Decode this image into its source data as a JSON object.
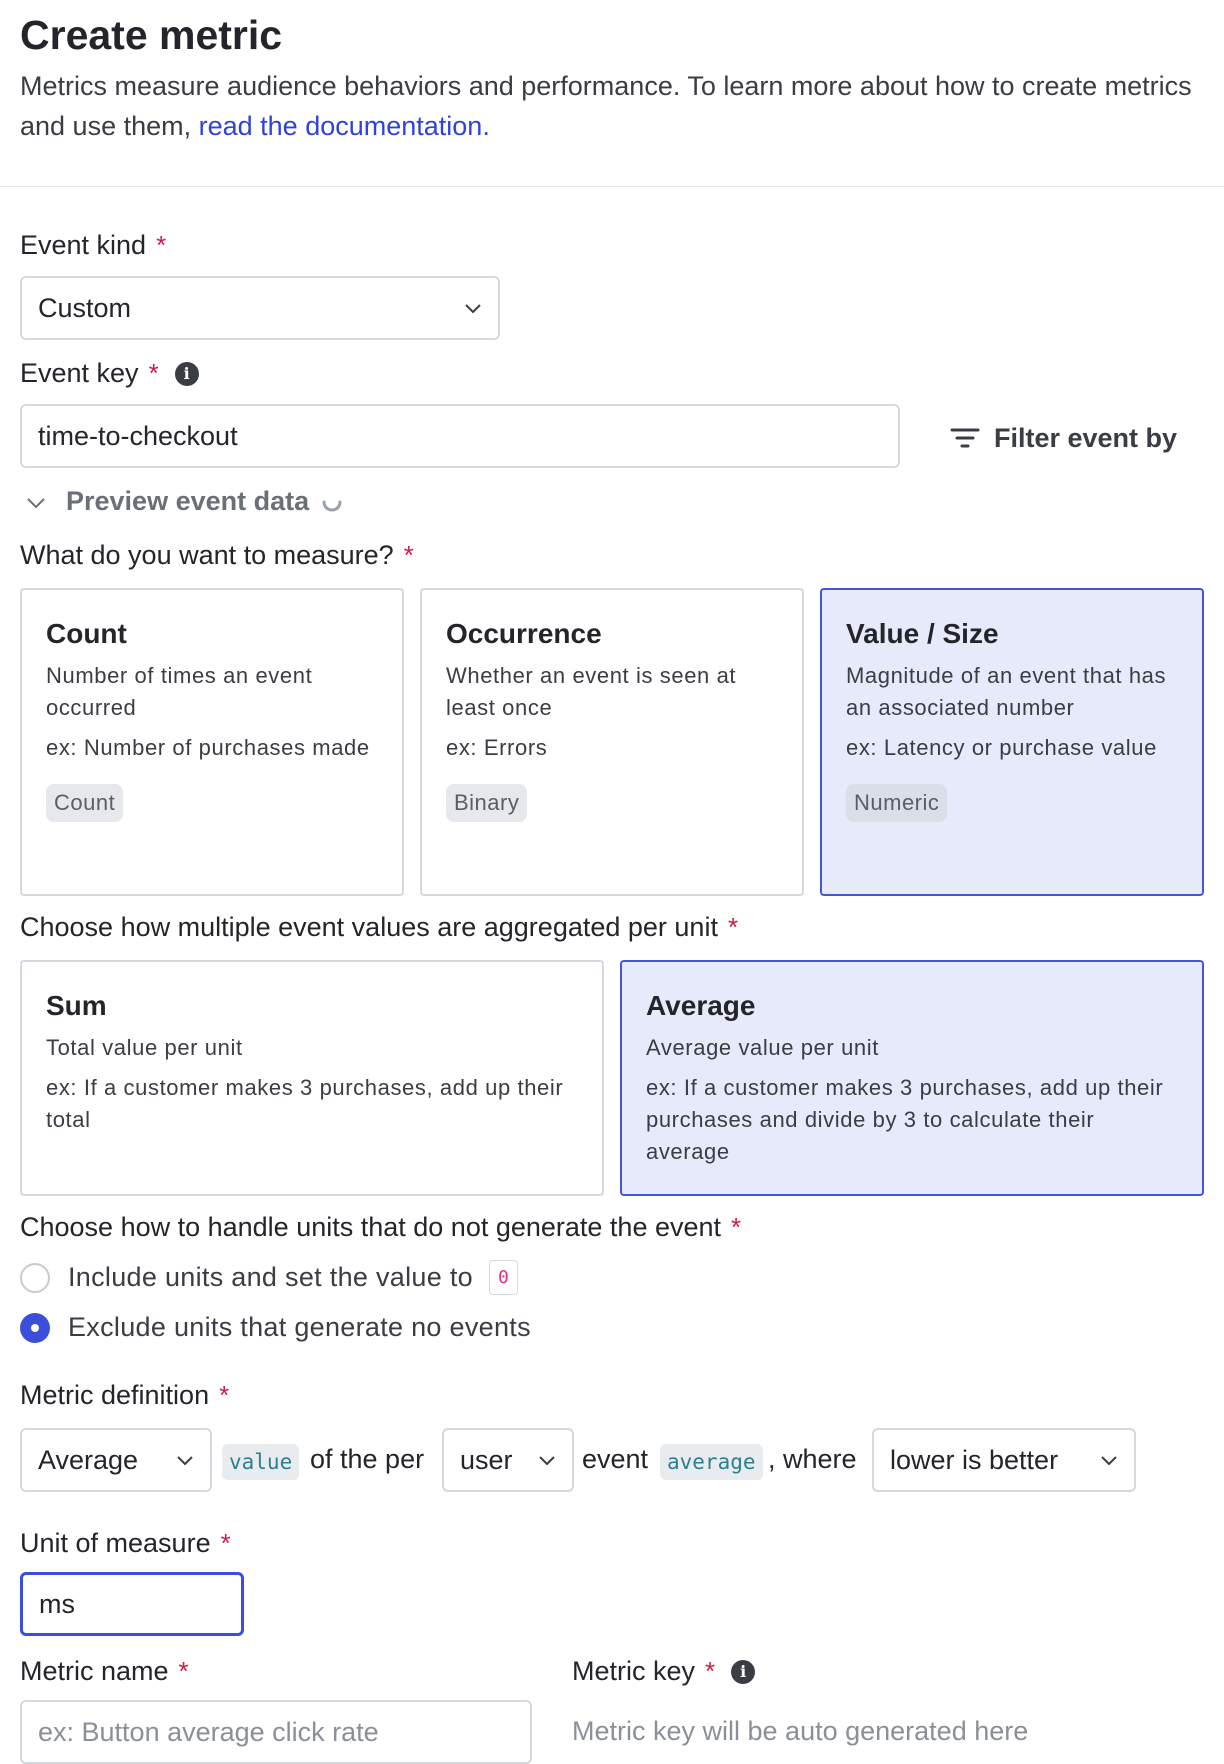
{
  "page": {
    "title": "Create metric",
    "description": "Metrics measure audience behaviors and performance. To learn more about how to create metrics and use them, ",
    "doc_link": "read the documentation."
  },
  "event_kind": {
    "label": "Event kind",
    "required": "*",
    "value": "Custom"
  },
  "event_key": {
    "label": "Event key",
    "required": "*",
    "value": "time-to-checkout",
    "info_icon": "info-icon"
  },
  "filter_button": {
    "label": "Filter event by",
    "icon": "filter-icon"
  },
  "preview": {
    "label": "Preview event data"
  },
  "measure": {
    "label": "What do you want to measure?",
    "required": "*",
    "options": [
      {
        "title": "Count",
        "desc": "Number of times an event occurred",
        "example": "ex: Number of purchases made",
        "tag": "Count",
        "selected": false
      },
      {
        "title": "Occurrence",
        "desc": "Whether an event is seen at least once",
        "example": "ex: Errors",
        "tag": "Binary",
        "selected": false
      },
      {
        "title": "Value / Size",
        "desc": "Magnitude of an event that has an associated number",
        "example": "ex: Latency or purchase value",
        "tag": "Numeric",
        "selected": true
      }
    ]
  },
  "aggregation": {
    "label": "Choose how multiple event values are aggregated per unit",
    "required": "*",
    "options": [
      {
        "title": "Sum",
        "desc": "Total value per unit",
        "example": "ex: If a customer makes 3 purchases, add up their total",
        "selected": false
      },
      {
        "title": "Average",
        "desc": "Average value per unit",
        "example": "ex: If a customer makes 3 purchases, add up their purchases and divide by 3 to calculate their average",
        "selected": true
      }
    ]
  },
  "missing_units": {
    "label": "Choose how to handle units that do not generate the event",
    "required": "*",
    "include_label": "Include units and set the value to",
    "include_value": "0",
    "exclude_label": "Exclude units that generate no events",
    "selected": "exclude"
  },
  "metric_definition": {
    "label": "Metric definition",
    "required": "*",
    "aggregate": "Average",
    "value_chip": "value",
    "of_the_per": "of the per",
    "unit": "user",
    "event_text": "event",
    "average_chip": "average",
    "where_text": ", where",
    "direction": "lower is better"
  },
  "unit_of_measure": {
    "label": "Unit of measure",
    "required": "*",
    "value": "ms"
  },
  "metric_name": {
    "label": "Metric name",
    "required": "*",
    "placeholder": "ex: Button average click rate"
  },
  "metric_key": {
    "label": "Metric key",
    "required": "*",
    "placeholder": "Metric key will be auto generated here",
    "info_icon": "info-icon"
  },
  "colors": {
    "accent": "#3c4fdb",
    "selected_bg": "#e7eafb",
    "required": "#c81e49",
    "link": "#3043d8"
  }
}
